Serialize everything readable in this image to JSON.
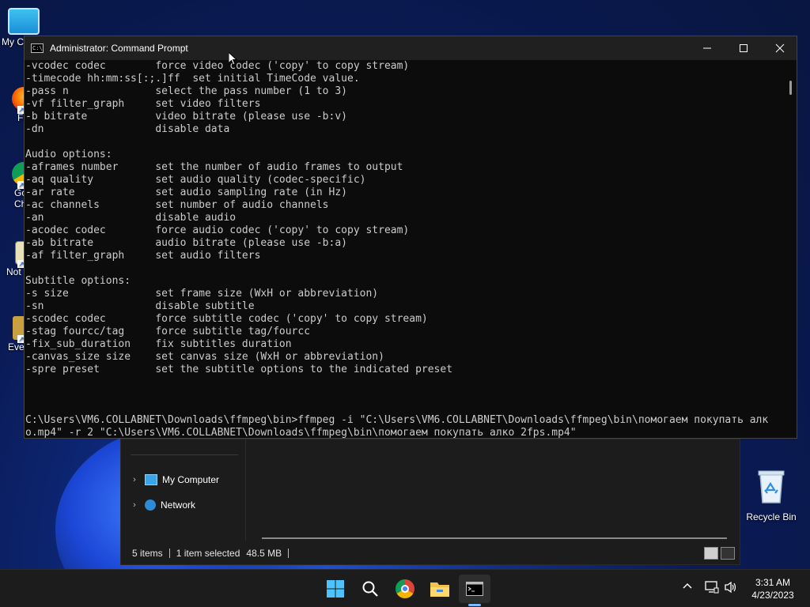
{
  "window": {
    "title": "Administrator: Command Prompt",
    "icon_label": "C:\\"
  },
  "console_lines": [
    "-vcodec codec        force video codec ('copy' to copy stream)",
    "-timecode hh:mm:ss[:;.]ff  set initial TimeCode value.",
    "-pass n              select the pass number (1 to 3)",
    "-vf filter_graph     set video filters",
    "-b bitrate           video bitrate (please use -b:v)",
    "-dn                  disable data",
    "",
    "Audio options:",
    "-aframes number      set the number of audio frames to output",
    "-aq quality          set audio quality (codec-specific)",
    "-ar rate             set audio sampling rate (in Hz)",
    "-ac channels         set number of audio channels",
    "-an                  disable audio",
    "-acodec codec        force audio codec ('copy' to copy stream)",
    "-ab bitrate          audio bitrate (please use -b:a)",
    "-af filter_graph     set audio filters",
    "",
    "Subtitle options:",
    "-s size              set frame size (WxH or abbreviation)",
    "-sn                  disable subtitle",
    "-scodec codec        force subtitle codec ('copy' to copy stream)",
    "-stag fourcc/tag     force subtitle tag/fourcc",
    "-fix_sub_duration    fix subtitles duration",
    "-canvas_size size    set canvas size (WxH or abbreviation)",
    "-spre preset         set the subtitle options to the indicated preset",
    "",
    "",
    "",
    "C:\\Users\\VM6.COLLABNET\\Downloads\\ffmpeg\\bin>ffmpeg -i \"C:\\Users\\VM6.COLLABNET\\Downloads\\ffmpeg\\bin\\помогаем покупать алк",
    "о.mp4\" -r 2 \"C:\\Users\\VM6.COLLABNET\\Downloads\\ffmpeg\\bin\\помогаем покупать алко 2fps.mp4\""
  ],
  "desktop_icons": [
    {
      "label": "My C"
    },
    {
      "label": "Fi"
    },
    {
      "label": "Go\nCh"
    },
    {
      "label": "Not"
    },
    {
      "label": "Eve"
    }
  ],
  "recycle_bin": {
    "label": "Recycle Bin"
  },
  "explorer": {
    "nav_items": [
      "My Computer",
      "Network"
    ],
    "status_items": "5 items",
    "status_selected": "1 item selected",
    "status_size": "48.5 MB"
  },
  "taskbar": {
    "time": "3:31 AM",
    "date": "4/23/2023"
  },
  "colors": {
    "console_bg": "#0c0c0c",
    "console_fg": "#cccccc",
    "titlebar_bg": "#202020",
    "taskbar_bg": "#1c1c1c",
    "accent": "#7ab8ff"
  }
}
